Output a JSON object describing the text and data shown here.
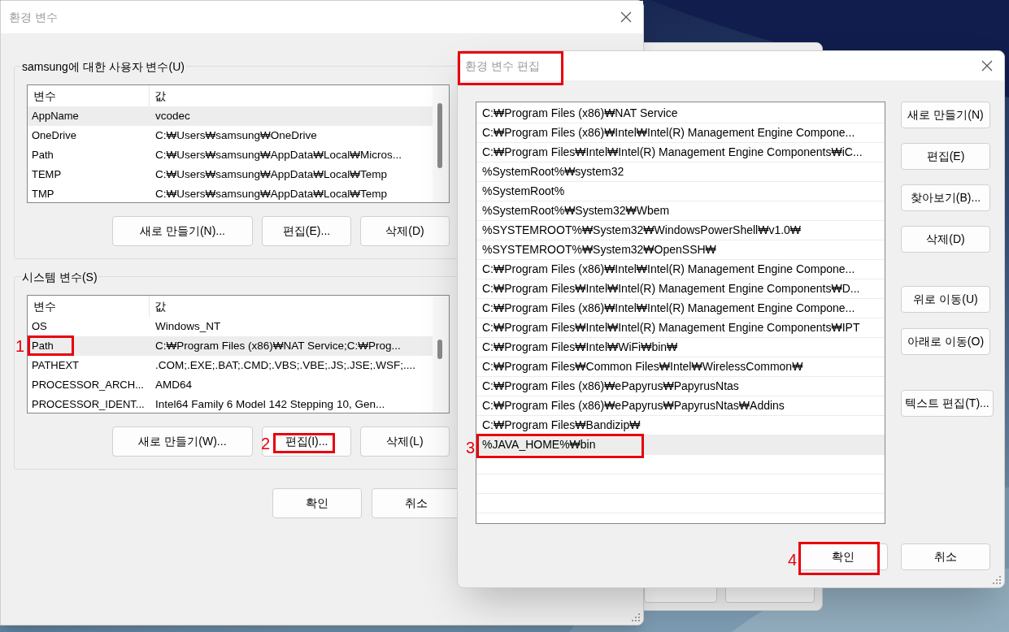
{
  "env_dialog": {
    "title": "환경 변수",
    "groups": [
      {
        "title": "samsung에 대한 사용자 변수(U)",
        "columns": [
          "변수",
          "값"
        ],
        "rows": [
          {
            "name": "AppName",
            "value": "vcodec",
            "selected": true
          },
          {
            "name": "OneDrive",
            "value": "C:₩Users₩samsung₩OneDrive",
            "selected": false
          },
          {
            "name": "Path",
            "value": "C:₩Users₩samsung₩AppData₩Local₩Micros...",
            "selected": false
          },
          {
            "name": "TEMP",
            "value": "C:₩Users₩samsung₩AppData₩Local₩Temp",
            "selected": false
          },
          {
            "name": "TMP",
            "value": "C:₩Users₩samsung₩AppData₩Local₩Temp",
            "selected": false
          }
        ],
        "buttons": [
          {
            "label": "새로 만들기(N)..."
          },
          {
            "label": "편집(E)..."
          },
          {
            "label": "삭제(D)"
          }
        ]
      },
      {
        "title": "시스템 변수(S)",
        "columns": [
          "변수",
          "값"
        ],
        "rows": [
          {
            "name": "OS",
            "value": "Windows_NT",
            "selected": false
          },
          {
            "name": "Path",
            "value": "C:₩Program Files (x86)₩NAT Service;C:₩Prog...",
            "selected": true,
            "marker": "1"
          },
          {
            "name": "PATHEXT",
            "value": ".COM;.EXE;.BAT;.CMD;.VBS;.VBE;.JS;.JSE;.WSF;....",
            "selected": false
          },
          {
            "name": "PROCESSOR_ARCH...",
            "value": "AMD64",
            "selected": false
          },
          {
            "name": "PROCESSOR_IDENT...",
            "value": "Intel64 Family 6 Model 142 Stepping 10, Gen...",
            "selected": false
          }
        ],
        "buttons": [
          {
            "label": "새로 만들기(W)..."
          },
          {
            "label": "편집(I)...",
            "marker": "2"
          },
          {
            "label": "삭제(L)"
          }
        ]
      }
    ],
    "buttons": [
      {
        "label": "확인"
      },
      {
        "label": "취소"
      }
    ]
  },
  "edit_dialog": {
    "title": "환경 변수 편집",
    "title_highlighted": true,
    "entries": [
      {
        "text": "C:₩Program Files (x86)₩NAT Service",
        "selected": false
      },
      {
        "text": "C:₩Program Files (x86)₩Intel₩Intel(R) Management Engine Compone...",
        "selected": false
      },
      {
        "text": "C:₩Program Files₩Intel₩Intel(R) Management Engine Components₩iC...",
        "selected": false
      },
      {
        "text": "%SystemRoot%₩system32",
        "selected": false
      },
      {
        "text": "%SystemRoot%",
        "selected": false
      },
      {
        "text": "%SystemRoot%₩System32₩Wbem",
        "selected": false
      },
      {
        "text": "%SYSTEMROOT%₩System32₩WindowsPowerShell₩v1.0₩",
        "selected": false
      },
      {
        "text": "%SYSTEMROOT%₩System32₩OpenSSH₩",
        "selected": false
      },
      {
        "text": "C:₩Program Files (x86)₩Intel₩Intel(R) Management Engine Compone...",
        "selected": false
      },
      {
        "text": "C:₩Program Files₩Intel₩Intel(R) Management Engine Components₩D...",
        "selected": false
      },
      {
        "text": "C:₩Program Files (x86)₩Intel₩Intel(R) Management Engine Compone...",
        "selected": false
      },
      {
        "text": "C:₩Program Files₩Intel₩Intel(R) Management Engine Components₩IPT",
        "selected": false
      },
      {
        "text": "C:₩Program Files₩Intel₩WiFi₩bin₩",
        "selected": false
      },
      {
        "text": "C:₩Program Files₩Common Files₩Intel₩WirelessCommon₩",
        "selected": false
      },
      {
        "text": "C:₩Program Files (x86)₩ePapyrus₩PapyrusNtas",
        "selected": false
      },
      {
        "text": "C:₩Program Files (x86)₩ePapyrus₩PapyrusNtas₩Addins",
        "selected": false
      },
      {
        "text": "C:₩Program Files₩Bandizip₩",
        "selected": false
      },
      {
        "text": "%JAVA_HOME%₩bin",
        "selected": true,
        "marker": "3"
      }
    ],
    "side_buttons": [
      {
        "label": "새로 만들기(N)"
      },
      {
        "label": "편집(E)"
      },
      {
        "label": "찾아보기(B)..."
      },
      {
        "label": "삭제(D)"
      },
      {
        "label": "위로 이동(U)"
      },
      {
        "label": "아래로 이동(O)"
      },
      {
        "label": "텍스트 편집(T)..."
      }
    ],
    "buttons": [
      {
        "label": "확인",
        "marker": "4"
      },
      {
        "label": "취소"
      }
    ]
  }
}
